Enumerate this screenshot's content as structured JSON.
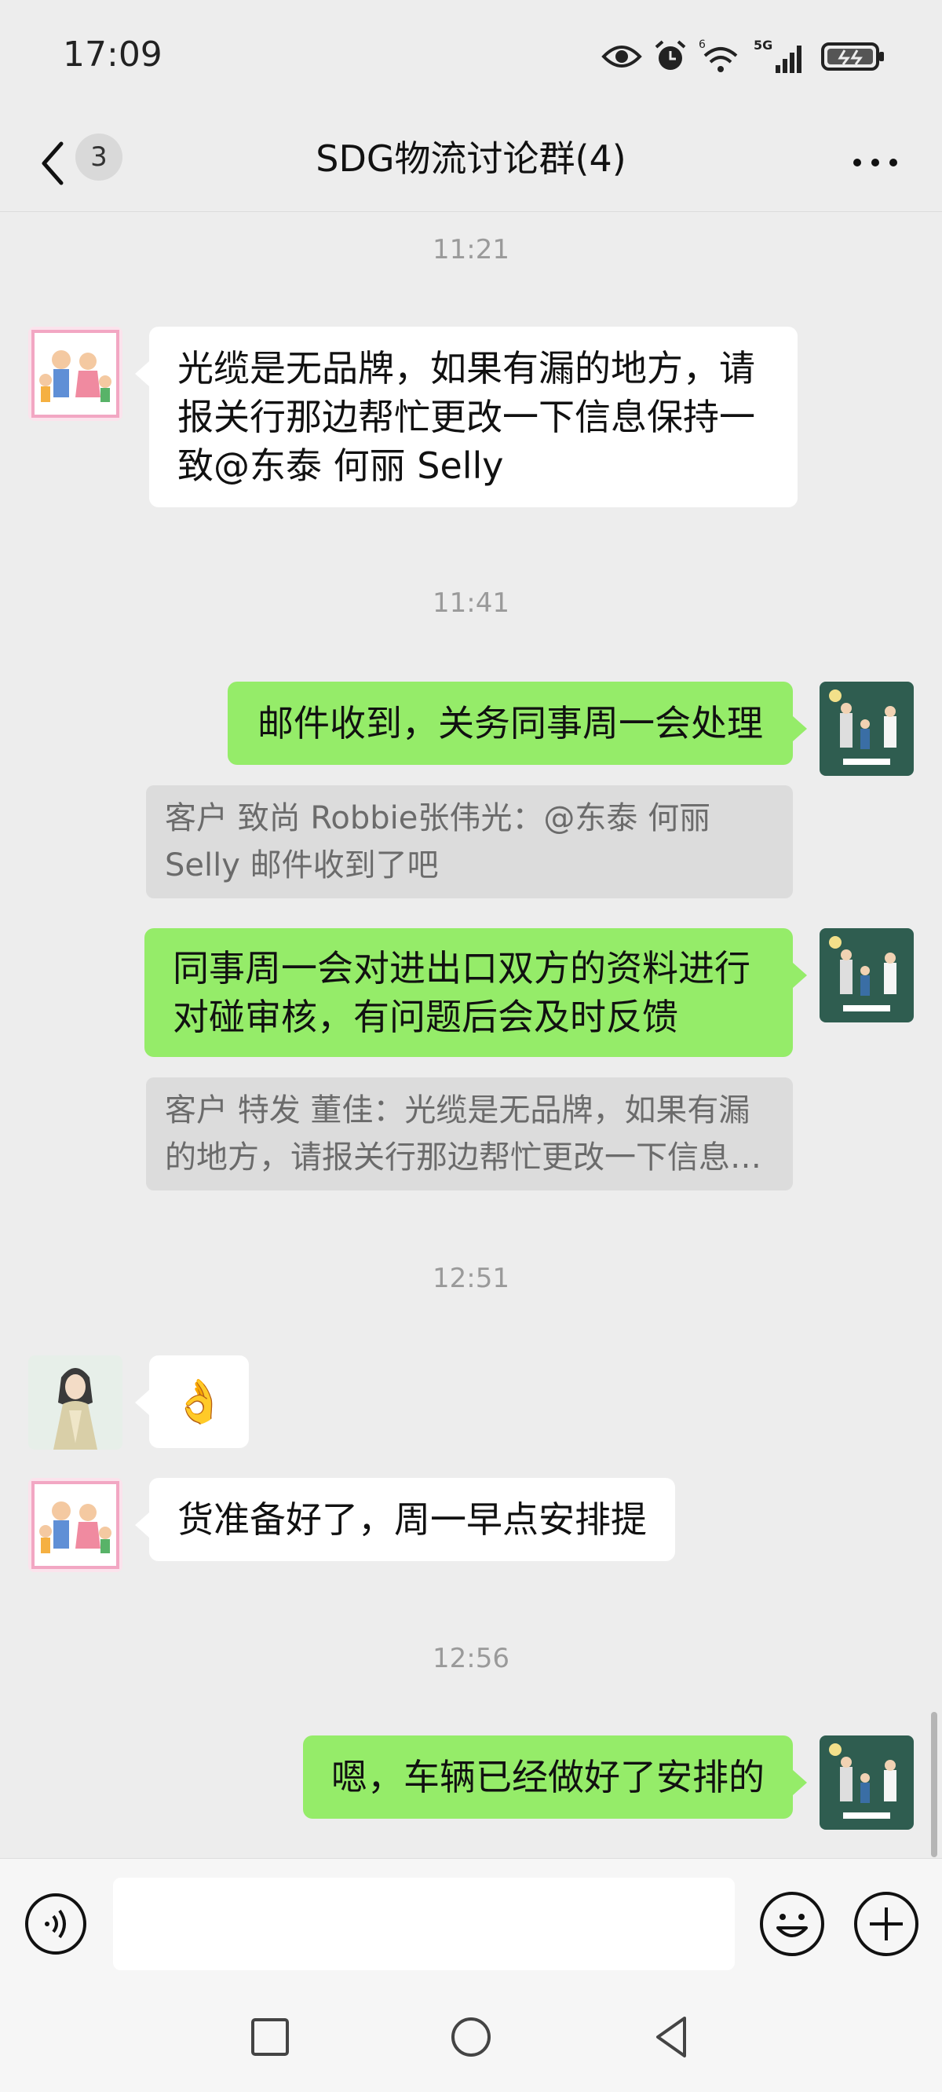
{
  "status_bar": {
    "time": "17:09",
    "network": "5G",
    "sim_slot": "6"
  },
  "nav": {
    "unread_count": "3",
    "title": "SDG物流讨论群(4)"
  },
  "messages": {
    "ts1": "11:21",
    "m1": "光缆是无品牌，如果有漏的地方，请报关行那边帮忙更改一下信息保持一致@东泰  何丽 Selly",
    "ts2": "11:41",
    "m2": "邮件收到，关务同事周一会处理",
    "q2": "客户 致尚 Robbie张伟光：@东泰  何丽 Selly 邮件收到了吧",
    "m3": "同事周一会对进出口双方的资料进行对碰审核，有问题后会及时反馈",
    "q3": "客户 特发 董佳：光缆是无品牌，如果有漏的地方，请报关行那边帮忙更改一下信息保持一致@东泰  何丽 Selly",
    "ts3": "12:51",
    "m4_emoji": "👌",
    "m5": "货准备好了，周一早点安排提",
    "ts4": "12:56",
    "m6": "嗯，车辆已经做好了安排的"
  },
  "input": {
    "value": "",
    "placeholder": ""
  },
  "colors": {
    "outgoing": "#95ec69",
    "incoming": "#ffffff",
    "background": "#ededed"
  }
}
